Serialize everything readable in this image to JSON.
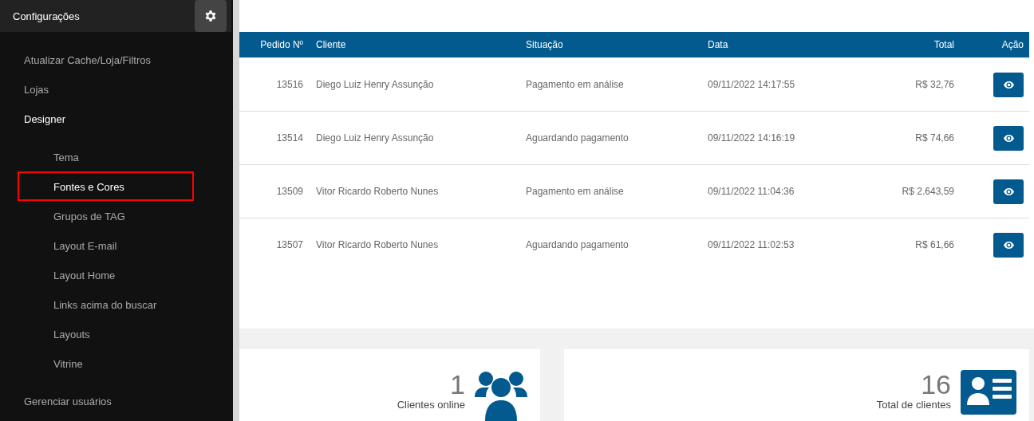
{
  "sidebar": {
    "title": "Configurações",
    "items": [
      {
        "label": "Atualizar Cache/Loja/Filtros",
        "expanded": false
      },
      {
        "label": "Lojas",
        "expanded": false
      },
      {
        "label": "Designer",
        "expanded": true,
        "children": [
          {
            "label": "Tema",
            "selected": false
          },
          {
            "label": "Fontes e Cores",
            "selected": true
          },
          {
            "label": "Grupos de TAG",
            "selected": false
          },
          {
            "label": "Layout E-mail",
            "selected": false
          },
          {
            "label": "Layout Home",
            "selected": false
          },
          {
            "label": "Links acima do buscar",
            "selected": false
          },
          {
            "label": "Layouts",
            "selected": false
          },
          {
            "label": "Vitrine",
            "selected": false
          }
        ]
      },
      {
        "label": "Gerenciar usuários",
        "expanded": false
      }
    ]
  },
  "orders_table": {
    "columns": [
      "Pedido Nº",
      "Cliente",
      "Situação",
      "Data",
      "Total",
      "Ação"
    ],
    "rows": [
      {
        "number": "13516",
        "client": "Diego Luiz Henry Assunção",
        "status": "Pagamento em análise",
        "date": "09/11/2022 14:17:55",
        "total": "R$ 32,76"
      },
      {
        "number": "13514",
        "client": "Diego Luiz Henry Assunção",
        "status": "Aguardando pagamento",
        "date": "09/11/2022 14:16:19",
        "total": "R$ 74,66"
      },
      {
        "number": "13509",
        "client": "Vitor Ricardo Roberto Nunes",
        "status": "Pagamento em análise",
        "date": "09/11/2022 11:04:36",
        "total": "R$ 2.643,59"
      },
      {
        "number": "13507",
        "client": "Vitor Ricardo Roberto Nunes",
        "status": "Aguardando pagamento",
        "date": "09/11/2022 11:02:53",
        "total": "R$ 61,66"
      }
    ]
  },
  "stats": [
    {
      "kind": "people",
      "value": "1",
      "label": "Clientes online"
    },
    {
      "kind": "contact",
      "value": "16",
      "label": "Total de clientes"
    }
  ]
}
